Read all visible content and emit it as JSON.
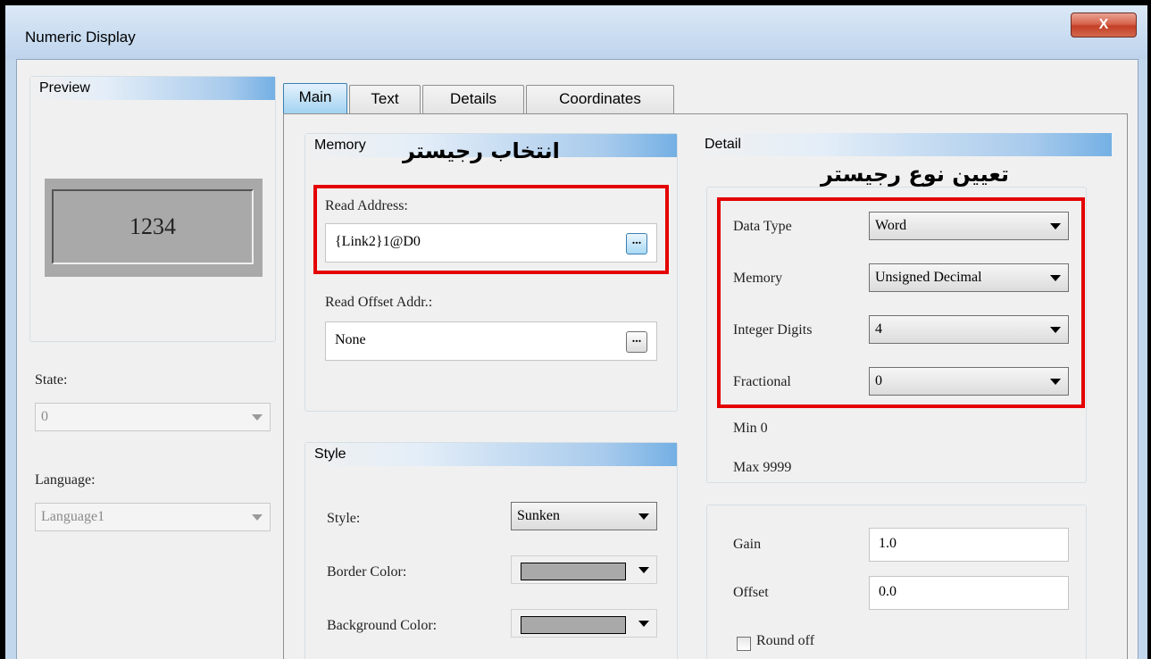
{
  "window": {
    "title": "Numeric Display",
    "close_label": "X"
  },
  "preview": {
    "header": "Preview",
    "value": "1234"
  },
  "state": {
    "label": "State:",
    "value": "0"
  },
  "language": {
    "label": "Language:",
    "value": "Language1"
  },
  "tabs": [
    {
      "label": "Main",
      "active": true
    },
    {
      "label": "Text",
      "active": false
    },
    {
      "label": "Details",
      "active": false
    },
    {
      "label": "Coordinates",
      "active": false
    }
  ],
  "memory": {
    "header": "Memory",
    "annotation": "انتخاب رجیستر",
    "read_address_label": "Read Address:",
    "read_address_value": "{Link2}1@D0",
    "offset_label": "Read Offset Addr.:",
    "offset_value": "None",
    "browse_label": "..."
  },
  "style": {
    "header": "Style",
    "style_label": "Style:",
    "style_value": "Sunken",
    "border_color_label": "Border Color:",
    "background_color_label": "Background Color:",
    "border_color": "#a9a9a9",
    "background_color": "#a9a9a9"
  },
  "detail": {
    "header": "Detail",
    "annotation": "تعیین نوع رجیستر",
    "data_type_label": "Data Type",
    "data_type_value": "Word",
    "memory_label": "Memory",
    "memory_value": "Unsigned Decimal",
    "integer_digits_label": "Integer Digits",
    "integer_digits_value": "4",
    "fractional_label": "Fractional",
    "fractional_value": "0",
    "min_text": "Min 0",
    "max_text": "Max 9999"
  },
  "scaling": {
    "gain_label": "Gain",
    "gain_value": "1.0",
    "offset_label": "Offset",
    "offset_value": "0.0",
    "round_off_label": "Round off"
  },
  "colors": {
    "highlight_box": "#e40000",
    "accent": "#74b0e4"
  }
}
